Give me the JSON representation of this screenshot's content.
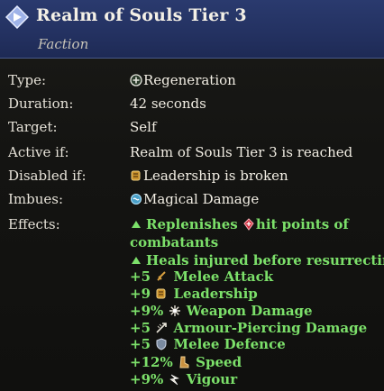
{
  "header": {
    "title": "Realm of Souls Tier 3",
    "subtitle": "Faction",
    "icon": "diamond-arrow-icon"
  },
  "rows": {
    "type_label": "Type:",
    "type_value": "Regeneration",
    "duration_label": "Duration:",
    "duration_value": "42 seconds",
    "target_label": "Target:",
    "target_value": "Self",
    "active_label": "Active if:",
    "active_value": "Realm of Souls Tier 3 is reached",
    "disabled_label": "Disabled if:",
    "disabled_value": "Leadership is broken",
    "imbues_label": "Imbues:",
    "imbues_value": "Magical Damage",
    "effects_label": "Effects:"
  },
  "effects": {
    "e1_line1_a": "Replenishes",
    "e1_line1_b": "hit points of",
    "e1_line2": "combatants",
    "e2": "Heals injured before resurrecting",
    "stats": [
      {
        "value": "+5",
        "label": "Melee Attack",
        "icon": "sword-icon"
      },
      {
        "value": "+9",
        "label": "Leadership",
        "icon": "banner-icon"
      },
      {
        "value": "+9%",
        "label": "Weapon Damage",
        "icon": "burst-icon"
      },
      {
        "value": "+5",
        "label": "Armour-Piercing Damage",
        "icon": "pierce-icon"
      },
      {
        "value": "+5",
        "label": "Melee Defence",
        "icon": "shield-icon"
      },
      {
        "value": "+12%",
        "label": "Speed",
        "icon": "boot-icon"
      },
      {
        "value": "+9%",
        "label": "Vigour",
        "icon": "vigour-icon"
      }
    ]
  },
  "colors": {
    "header_bg": "#243262",
    "effect_green": "#7ce06a",
    "text": "#e6e2d8"
  }
}
